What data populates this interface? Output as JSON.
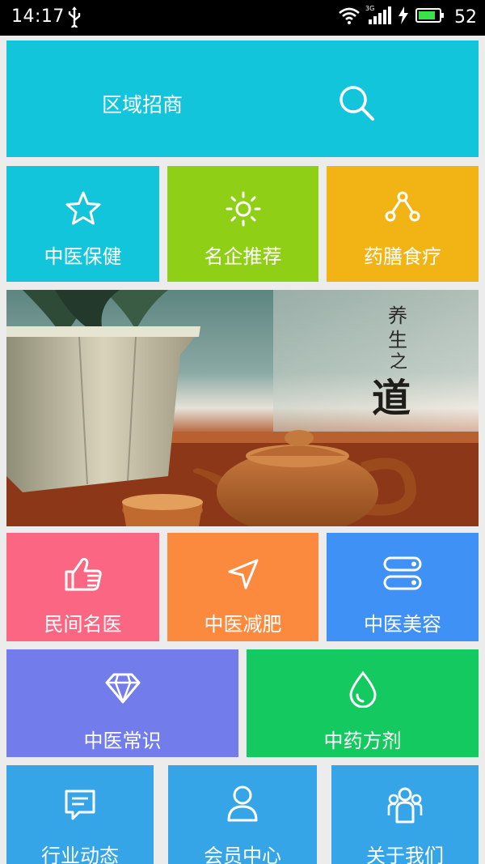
{
  "status_bar": {
    "time": "14:17",
    "network": "3G",
    "battery": "52"
  },
  "search": {
    "label": "区域招商"
  },
  "row1": [
    {
      "label": "中医保健",
      "icon": "star-icon",
      "color": "#12c5da"
    },
    {
      "label": "名企推荐",
      "icon": "sun-icon",
      "color": "#8fcf16"
    },
    {
      "label": "药膳食疗",
      "icon": "nodes-icon",
      "color": "#f2b415"
    }
  ],
  "banner": {
    "calligraphy": "养生之道"
  },
  "row2": [
    {
      "label": "民间名医",
      "icon": "thumbs-up-icon",
      "color": "#fb6782"
    },
    {
      "label": "中医减肥",
      "icon": "navigation-arrow-icon",
      "color": "#fb8a3e"
    },
    {
      "label": "中医美容",
      "icon": "toggle-list-icon",
      "color": "#3f91f5"
    }
  ],
  "row3": [
    {
      "label": "中医常识",
      "icon": "diamond-icon",
      "color": "#727cea"
    },
    {
      "label": "中药方剂",
      "icon": "water-drop-icon",
      "color": "#14c960"
    }
  ],
  "row4": [
    {
      "label": "行业动态",
      "icon": "message-icon",
      "color": "#35a5e8"
    },
    {
      "label": "会员中心",
      "icon": "user-icon",
      "color": "#35a5e8"
    },
    {
      "label": "关于我们",
      "icon": "group-icon",
      "color": "#35a5e8"
    }
  ]
}
